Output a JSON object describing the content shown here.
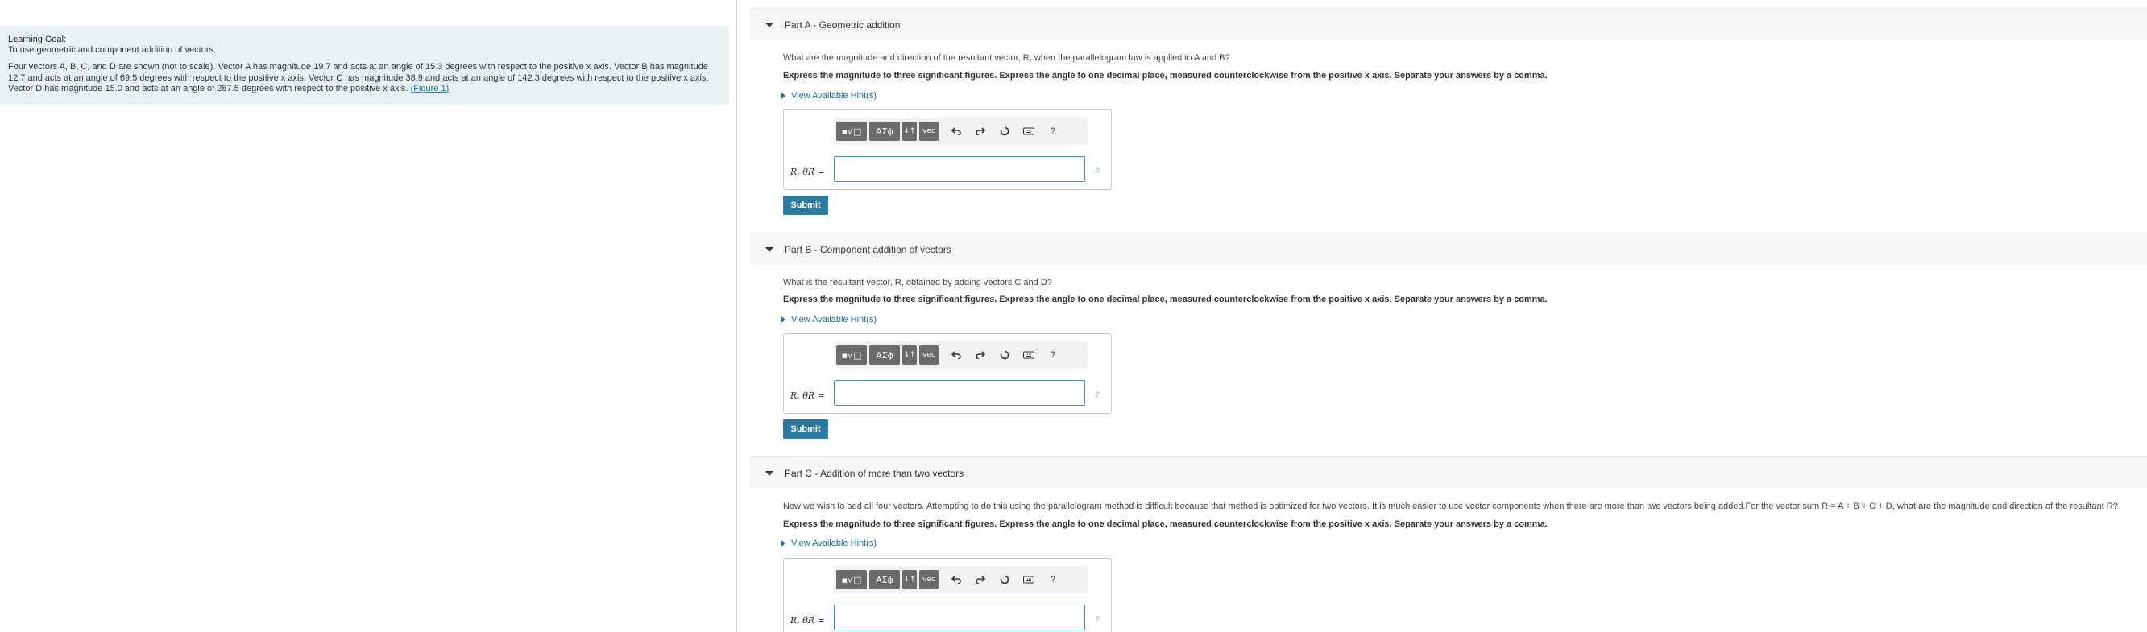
{
  "learning_goal": {
    "title": "Learning Goal:",
    "subtitle": "To use geometric and component addition of vectors.",
    "text_line1": "Four vectors A, B, C, and D are shown (not to scale). Vector A has magnitude 19.7 and acts at an angle of 15.3 degrees with respect to the positive x axis. Vector B has magnitude",
    "text_line2": "12.7 and acts at an angle of 69.5 degrees with respect to the positive x axis. Vector C has magnitude 38.9 and acts at an angle of 142.3 degrees with respect to the positive x axis.",
    "text_line3": "Vector D has magnitude 15.0 and acts at an angle of 287.5 degrees with respect to the positive x axis.",
    "figure_link": "(Figure 1)"
  },
  "toolbar": {
    "btn_templates": "▪√□",
    "btn_symbols": "AΣϕ",
    "btn_arrows": "↓↑",
    "btn_vec": "vec",
    "help": "?"
  },
  "instruction": "Express the magnitude to three significant figures. Express the angle to one decimal place, measured counterclockwise from the positive x axis. Separate your answers by a comma.",
  "hint_label": "View Available Hint(s)",
  "answer_label": "R, θR =",
  "submit_label": "Submit",
  "parts": [
    {
      "title": "Part A - Geometric addition",
      "question": "What are the magnitude and direction of the resultant vector, R, when the parallelogram law is applied to A and B?"
    },
    {
      "title": "Part B - Component addition of vectors",
      "question": "What is the resultant vector, R, obtained by adding vectors C and D?"
    },
    {
      "title": "Part C - Addition of more than two vectors",
      "question": "Now we wish to add all four vectors. Attempting to do this using the parallelogram method is difficult because that method is optimized for two vectors. It is much easier to use vector components when there are more than two vectors being added.For the vector sum R = A + B + C + D, what are the magnitude and direction of the resultant R?"
    }
  ]
}
